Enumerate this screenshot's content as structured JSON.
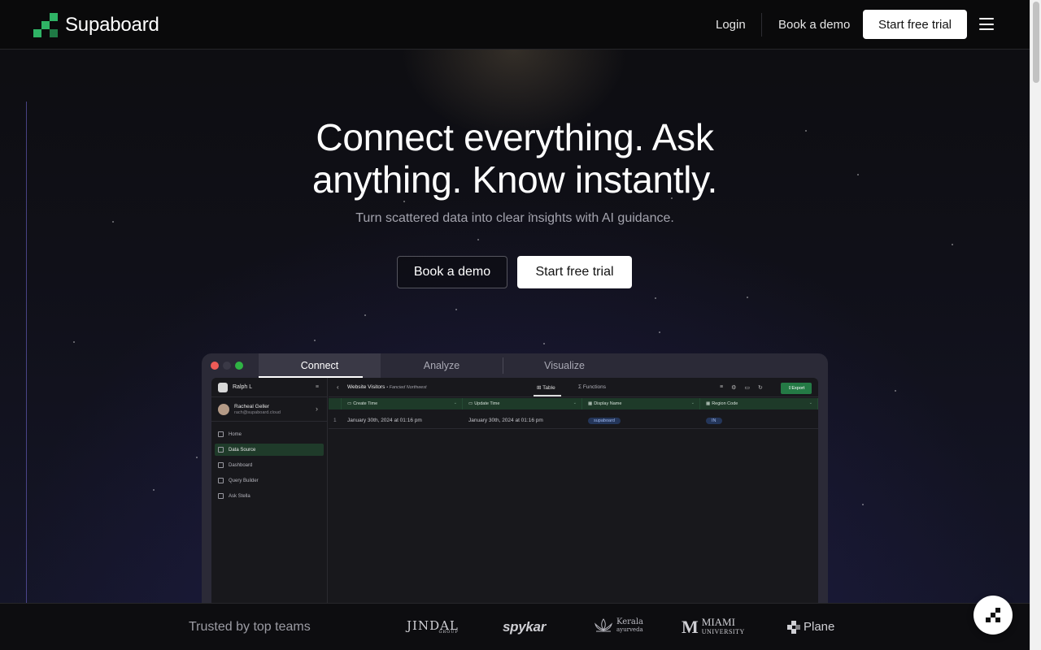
{
  "brand": {
    "name": "Supaboard"
  },
  "nav": {
    "login": "Login",
    "book_demo": "Book a demo",
    "start_trial": "Start free trial",
    "menu_icon": "hamburger-icon"
  },
  "hero": {
    "title_line1": "Connect everything. Ask",
    "title_line2": "anything. Know instantly.",
    "subtitle": "Turn scattered data into clear insights with AI guidance.",
    "book_demo": "Book a demo",
    "start_trial": "Start free trial"
  },
  "app": {
    "tabs": [
      "Connect",
      "Analyze",
      "Visualize"
    ],
    "active_tab": "Connect",
    "workspace": "Ralph L",
    "profile": {
      "name": "Racheal Geller",
      "email": "rach@supaboard.cloud"
    },
    "sidebar": [
      {
        "label": "Home",
        "icon": "home-icon"
      },
      {
        "label": "Data Source",
        "icon": "database-icon",
        "active": true
      },
      {
        "label": "Dashboard",
        "icon": "dashboard-icon"
      },
      {
        "label": "Query Builder",
        "icon": "chart-icon"
      },
      {
        "label": "Ask Stella",
        "icon": "chat-icon"
      }
    ],
    "toolbar": {
      "title": "Website Visitors",
      "subtitle": "• Fancied Northwest",
      "table_tab": "Table",
      "functions_tab": "Functions",
      "export": "Export"
    },
    "columns": [
      "Create Time",
      "Update Time",
      "Display Name",
      "Region Code"
    ],
    "rows": [
      {
        "index": "1",
        "create_time": "January 30th, 2024 at 01:16 pm",
        "update_time": "January 30th, 2024 at 01:16 pm",
        "display_name": "supaboard",
        "region_code": "IN"
      }
    ]
  },
  "trusted": {
    "label": "Trusted by top teams",
    "logos": {
      "jindal": "JINDAL",
      "jindal_sub": "GROUP",
      "spykar": "spykar",
      "kerala_1": "Kerala",
      "kerala_2": "ayurveda",
      "miami_1": "MIAMI",
      "miami_2": "UNIVERSITY",
      "plane": "Plane"
    }
  },
  "colors": {
    "accent_green": "#2fb365",
    "background": "#0c0c0e",
    "button_bg": "#ffffff"
  }
}
